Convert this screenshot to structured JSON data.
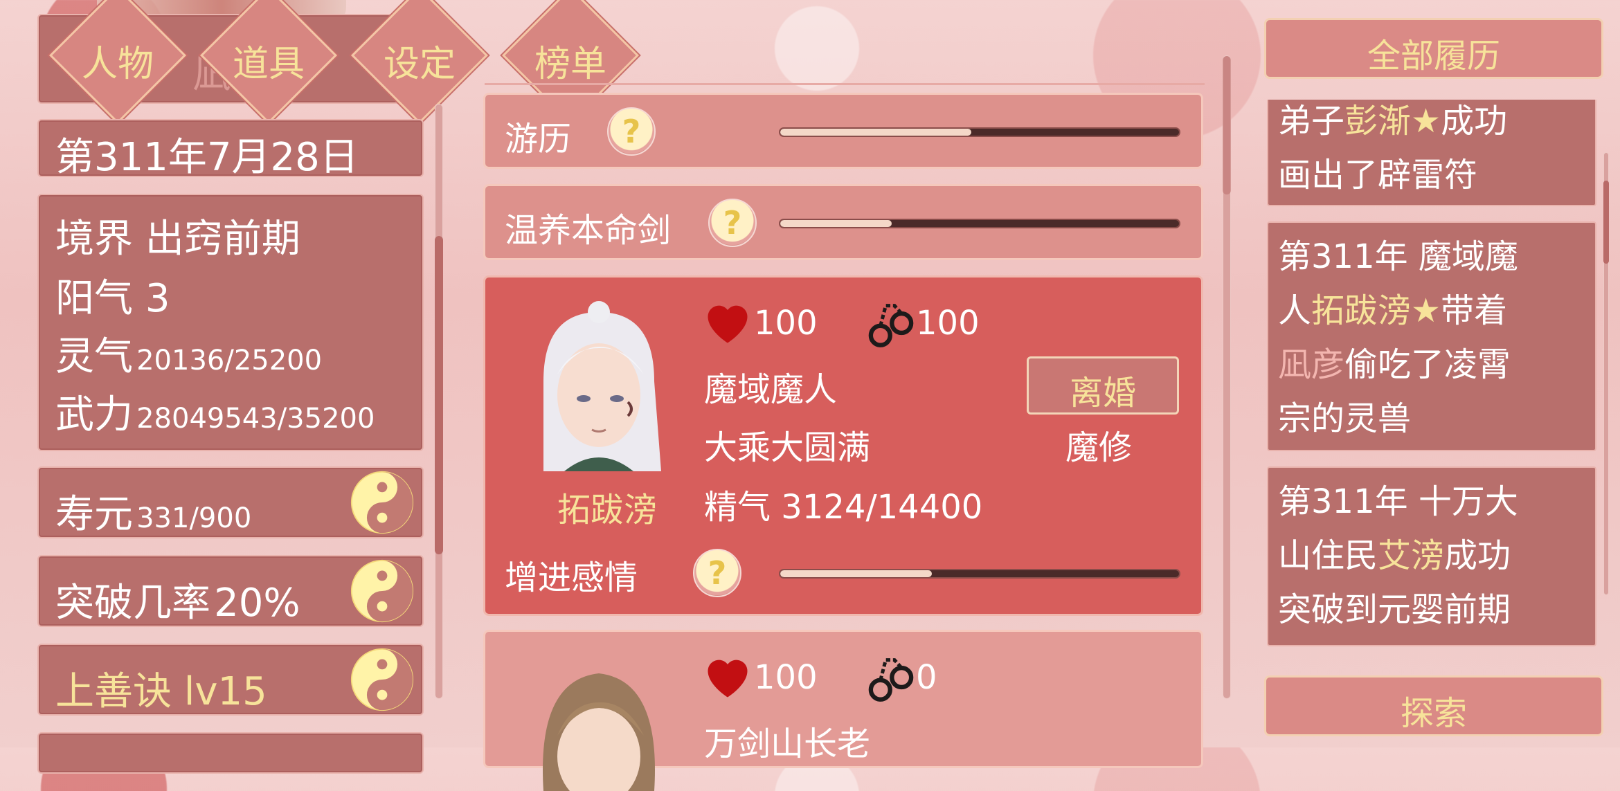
{
  "nav": {
    "tabs": [
      {
        "label": "人物"
      },
      {
        "label": "道具"
      },
      {
        "label": "设定"
      },
      {
        "label": "榜单"
      }
    ],
    "behind_label": "凪彦"
  },
  "left": {
    "date": "第311年7月28日",
    "stats": {
      "realm_label": "境界",
      "realm_value": "出窍前期",
      "yang_label": "阳气",
      "yang_value": "3",
      "qi_label": "灵气",
      "qi_value": "20136/25200",
      "power_label": "武力",
      "power_value": "28049543/35200"
    },
    "rows": [
      {
        "label": "寿元",
        "value": "331/900"
      },
      {
        "label": "突破几率",
        "value": "20%"
      },
      {
        "label": "上善诀 lv15",
        "value": ""
      }
    ]
  },
  "middle": {
    "activities": [
      {
        "label": "游历",
        "progress": 0.48
      },
      {
        "label": "温养本命剑",
        "progress": 0.28
      }
    ],
    "characters": [
      {
        "name": "拓跋滂",
        "heart": "100",
        "bond": "100",
        "origin": "魔域魔人",
        "realm": "大乘大圆满",
        "essence_label": "精气",
        "essence": "3124/14400",
        "action": "离婚",
        "path": "魔修",
        "affection_label": "增进感情",
        "affection_progress": 0.38
      },
      {
        "heart": "100",
        "bond": "0",
        "origin": "万剑山长老"
      }
    ]
  },
  "right": {
    "header": "全部履历",
    "entries": [
      {
        "lines": [
          [
            {
              "t": "弟子",
              "c": "w"
            },
            {
              "t": "彭渐★",
              "c": "g"
            },
            {
              "t": "成功",
              "c": "w"
            }
          ],
          [
            {
              "t": "画出了辟雷符",
              "c": "w"
            }
          ]
        ]
      },
      {
        "lines": [
          [
            {
              "t": "第311年 魔域魔",
              "c": "w"
            }
          ],
          [
            {
              "t": "人",
              "c": "w"
            },
            {
              "t": "拓跋滂★",
              "c": "g"
            },
            {
              "t": "带着",
              "c": "w"
            }
          ],
          [
            {
              "t": "凪彦",
              "c": "p"
            },
            {
              "t": "偷吃了凌霄",
              "c": "w"
            }
          ],
          [
            {
              "t": "宗的灵兽",
              "c": "w"
            }
          ]
        ]
      },
      {
        "lines": [
          [
            {
              "t": "第311年 十万大",
              "c": "w"
            }
          ],
          [
            {
              "t": "山住民",
              "c": "w"
            },
            {
              "t": "艾滂",
              "c": "g"
            },
            {
              "t": "成功",
              "c": "w"
            }
          ],
          [
            {
              "t": "突破到元婴前期",
              "c": "w"
            }
          ]
        ]
      }
    ],
    "explore": "探索"
  },
  "colors": {
    "accent_gold": "#f7e39a",
    "panel": "#b86f6c",
    "card_red": "#d75e5c"
  }
}
